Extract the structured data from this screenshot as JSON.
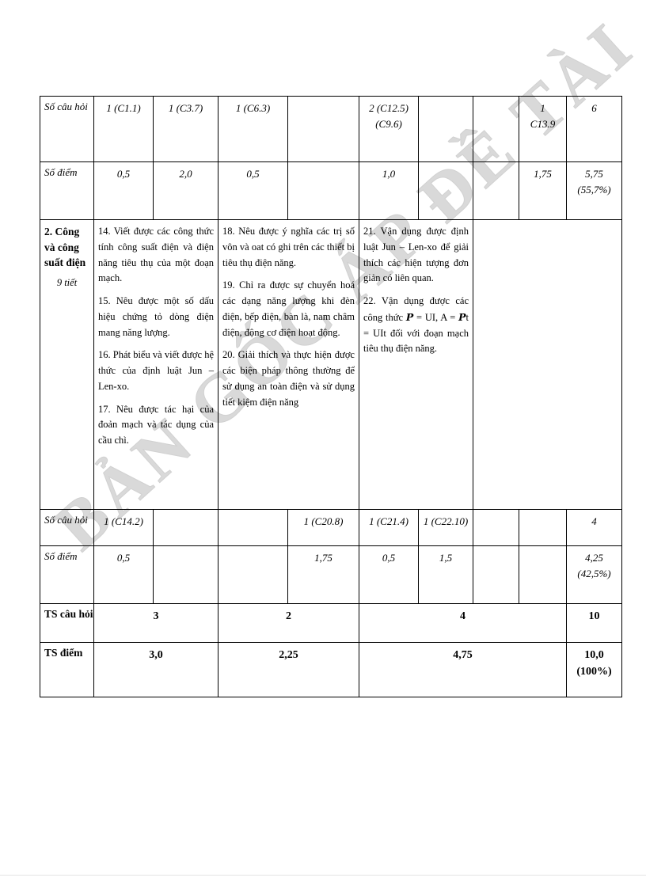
{
  "watermark": {
    "text": "BẢN GỐC ÁP ĐỀ TÀI"
  },
  "table": {
    "labels": {
      "so_cau_hoi": "Số câu hỏi",
      "so_diem": "Số điểm",
      "ts_cau_hoi": "TS câu hỏi",
      "ts_diem": "TS điểm"
    },
    "row_count_1": {
      "label": "Số câu hỏi",
      "c1": "1 (C1.1)",
      "c2": "1 (C3.7)",
      "c3": "1 (C6.3)",
      "c4": "",
      "c5_line1": "2 (C12.5)",
      "c5_line2": "(C9.6)",
      "c6": "",
      "c7": "",
      "c8_line1": "1",
      "c8_line2": "C13.9",
      "c9": "6"
    },
    "row_points_1": {
      "label": "Số điểm",
      "c1": "0,5",
      "c2": "2,0",
      "c3": "0,5",
      "c4": "",
      "c5": "1,0",
      "c6": "",
      "c7": "",
      "c8": "1,75",
      "c9_line1": "5,75",
      "c9_line2": "(55,7%)"
    },
    "row_content": {
      "topic_title": "2. Công và công suất điện",
      "topic_hours": "9 tiết",
      "col_knowledge": [
        "14. Viết được các công thức tính công suất điện và điện năng tiêu thụ của một đoạn mạch.",
        "15. Nêu được một số dấu hiệu chứng tỏ dòng điện mang năng lượng.",
        "16. Phát biểu và viết được hệ thức của định luật Jun – Len-xo.",
        "17. Nêu được tác hại của đoản mạch và tác dụng của cầu chì."
      ],
      "col_understanding": [
        "18. Nêu được ý nghĩa các trị số vôn và oat có ghi trên các thiết bị tiêu thụ điện năng.",
        "19. Chỉ ra được sự chuyển hoá các dạng năng lượng khi đèn điện, bếp điện, bàn là, nam châm điện, động cơ điện hoạt động.",
        "20. Giải thích và thực hiện được các biện pháp thông thường để sử dụng an toàn điện và sử dụng tiết kiệm điện năng"
      ],
      "col_application_line1": "21. Vận dụng được định luật Jun – Len-xo để giải thích các hiện tượng đơn giản có liên quan.",
      "col_application_line2_pre": "22.    Vận dụng được các công thức ",
      "col_application_formula_1": "P",
      "col_application_line2_mid": " = UI, A = ",
      "col_application_formula_2": "P",
      "col_application_line2_post": "t = UIt đối với đoạn mạch tiêu thụ điện năng.",
      "col_empty": ""
    },
    "row_count_2": {
      "label": "Số câu hỏi",
      "c1": "1 (C14.2)",
      "c2": "",
      "c3": "",
      "c4": "1 (C20.8)",
      "c5": "1 (C21.4)",
      "c6": "1 (C22.10)",
      "c7": "",
      "c8": "",
      "c9": "4"
    },
    "row_points_2": {
      "label": "Số điểm",
      "c1": "0,5",
      "c2": "",
      "c3": "",
      "c4": "1,75",
      "c5": "0,5",
      "c6": "1,5",
      "c7": "",
      "c8": "",
      "c9_line1": "4,25",
      "c9_line2": "(42,5%)"
    },
    "row_ts_count": {
      "label": "TS câu hỏi",
      "g1": "3",
      "g2": "2",
      "g3": "4",
      "total": "10"
    },
    "row_ts_points": {
      "label": "TS điểm",
      "g1": "3,0",
      "g2": "2,25",
      "g3": "4,75",
      "total_line1": "10,0",
      "total_line2": "(100%)"
    }
  }
}
